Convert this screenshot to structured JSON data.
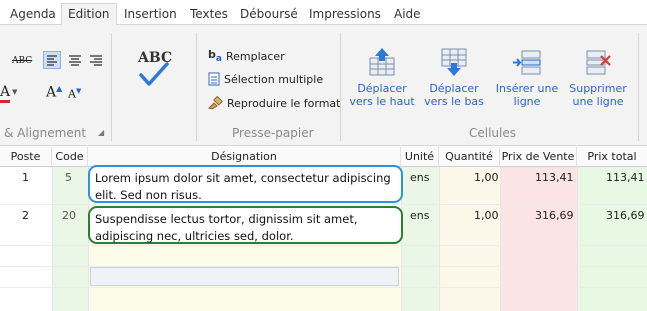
{
  "tabs": [
    "Agenda",
    "Edition",
    "Insertion",
    "Textes",
    "Déboursé",
    "Impressions",
    "Aide"
  ],
  "ribbon": {
    "align_group_label": "& Alignement",
    "spell_label": "ABC",
    "presse_papier": {
      "label": "Presse-papier",
      "remplacer": "Remplacer",
      "selection_multiple": "Sélection multiple",
      "reproduire": "Reproduire le format"
    },
    "cellules": {
      "label": "Cellules",
      "deplacer_haut": [
        "Déplacer",
        "vers le haut"
      ],
      "deplacer_bas": [
        "Déplacer",
        "vers le bas"
      ],
      "inserer_ligne": [
        "Insérer une",
        "ligne"
      ],
      "supprimer_ligne": [
        "Supprimer",
        "une ligne"
      ]
    }
  },
  "table": {
    "headers": [
      "Poste",
      "Code",
      "Désignation",
      "Unité",
      "Quantité",
      "Prix de Vente",
      "Prix total"
    ],
    "rows": [
      {
        "poste": "1",
        "code": "5",
        "designation": "Lorem ipsum dolor sit amet, consectetur adipiscing elit. Sed non risus.",
        "unite": "ens",
        "quantite": "1,00",
        "prix_vente": "113,41",
        "prix_total": "113,41"
      },
      {
        "poste": "2",
        "code": "20",
        "designation": "Suspendisse lectus tortor, dignissim sit amet, adipiscing nec, ultricies sed, dolor.",
        "unite": "ens",
        "quantite": "1,00",
        "prix_vente": "316,69",
        "prix_total": "316,69"
      }
    ]
  },
  "colors": {
    "code_col": "#eaf7e6",
    "desig_col": "#fbfbe9",
    "unite_col": "#eaf7e6",
    "quantite_col": "#fdf7e9",
    "prix_vente_col": "#fde4e4",
    "prix_total_col": "#e7f8e3",
    "box1_border": "#2b93dd",
    "box2_border": "#2e7d32"
  }
}
